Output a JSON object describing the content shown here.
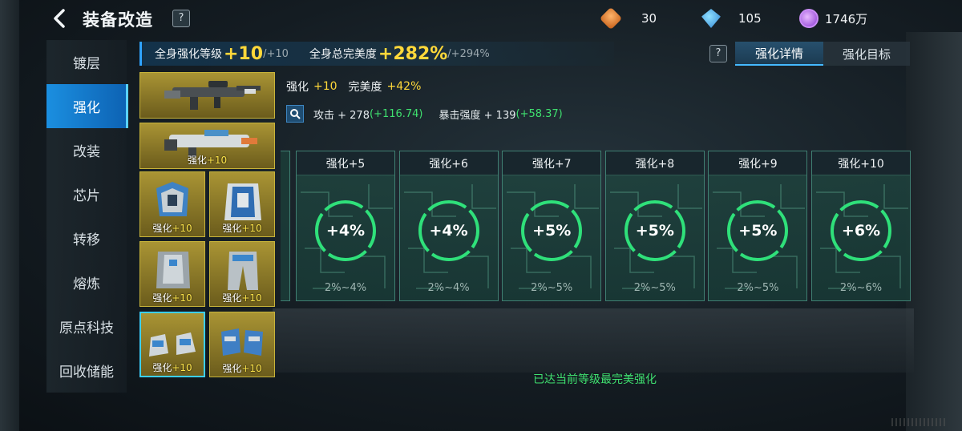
{
  "header": {
    "title": "装备改造",
    "help": "?"
  },
  "resources": [
    {
      "icon": "gold-gem-icon",
      "value": "30"
    },
    {
      "icon": "blue-crystal-icon",
      "value": "105"
    },
    {
      "icon": "purple-coin-icon",
      "value": "1746万"
    }
  ],
  "sidenav": {
    "items": [
      "镀层",
      "强化",
      "改装",
      "芯片",
      "转移",
      "熔炼",
      "原点科技",
      "回收储能"
    ],
    "active_index": 1
  },
  "stats": {
    "level_label": "全身强化等级",
    "level_value": "+10",
    "level_max": "/+10",
    "perfect_label": "全身总完美度",
    "perfect_value": "+282%",
    "perfect_max": "/+294%"
  },
  "tabs": {
    "help": "?",
    "detail": "强化详情",
    "goal": "强化目标"
  },
  "equipment": [
    {
      "name": "rifle",
      "level_prefix": "",
      "level": ""
    },
    {
      "name": "heavy-gun",
      "level_prefix": "强化",
      "level": "+10"
    },
    {
      "name": "armor-blue",
      "level_prefix": "强化",
      "level": "+10"
    },
    {
      "name": "vest-blue",
      "level_prefix": "强化",
      "level": "+10"
    },
    {
      "name": "chest-silver",
      "level_prefix": "强化",
      "level": "+10"
    },
    {
      "name": "pants-silver",
      "level_prefix": "强化",
      "level": "+10"
    },
    {
      "name": "boots",
      "level_prefix": "强化",
      "level": "+10"
    },
    {
      "name": "gloves",
      "level_prefix": "强化",
      "level": "+10"
    }
  ],
  "selected_item": {
    "enhance_label": "强化",
    "enhance_value": "+10",
    "perfect_label": "完美度",
    "perfect_value": "+42%",
    "attack_label": "攻击 + 278",
    "attack_bonus": "(+116.74)",
    "crit_label": "暴击强度 + 139",
    "crit_bonus": "(+58.37)"
  },
  "levels": [
    {
      "label": "强化+5",
      "value": "+4%",
      "range": "2%~4%",
      "fill": 1.0
    },
    {
      "label": "强化+6",
      "value": "+4%",
      "range": "2%~4%",
      "fill": 1.0
    },
    {
      "label": "强化+7",
      "value": "+5%",
      "range": "2%~5%",
      "fill": 1.0
    },
    {
      "label": "强化+8",
      "value": "+5%",
      "range": "2%~5%",
      "fill": 1.0
    },
    {
      "label": "强化+9",
      "value": "+5%",
      "range": "2%~5%",
      "fill": 1.0
    },
    {
      "label": "强化+10",
      "value": "+6%",
      "range": "2%~6%",
      "fill": 1.0
    }
  ],
  "status_message": "已达当前等级最完美强化",
  "colors": {
    "accent_blue": "#1b8fe0",
    "gold": "#ffd83a",
    "green": "#3fe06f",
    "ring_green": "#2fe07a"
  }
}
